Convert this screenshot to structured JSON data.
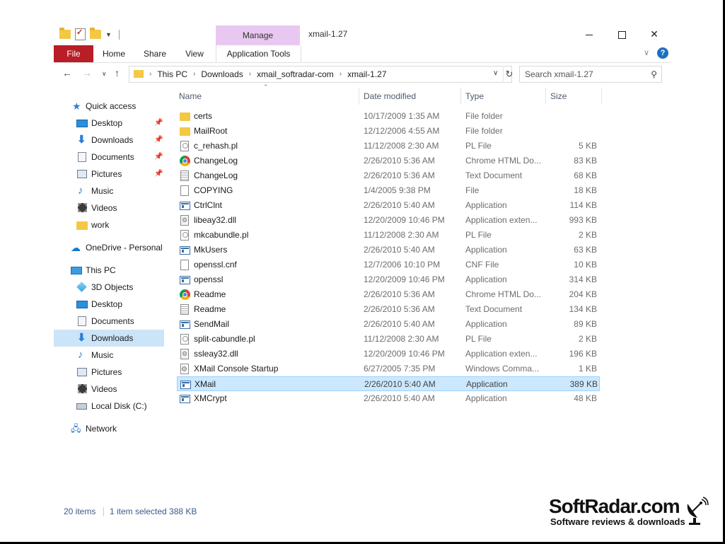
{
  "window": {
    "title": "xmail-1.27",
    "manage_label": "Manage"
  },
  "ribbon": {
    "tabs": [
      "File",
      "Home",
      "Share",
      "View",
      "Application Tools"
    ],
    "help_label": "?"
  },
  "address": {
    "crumbs": [
      "This PC",
      "Downloads",
      "xmail_softradar-com",
      "xmail-1.27"
    ]
  },
  "search": {
    "placeholder": "Search xmail-1.27"
  },
  "sidebar": {
    "items": [
      {
        "label": "Quick access",
        "icon": "star-icon"
      },
      {
        "label": "Desktop",
        "icon": "desktop-icon"
      },
      {
        "label": "Downloads",
        "icon": "download-arrow-icon"
      },
      {
        "label": "Documents",
        "icon": "document-icon"
      },
      {
        "label": "Pictures",
        "icon": "pictures-icon"
      },
      {
        "label": "Music",
        "icon": "music-note-icon"
      },
      {
        "label": "Videos",
        "icon": "video-icon"
      },
      {
        "label": "work",
        "icon": "folder-icon"
      },
      {
        "label": "OneDrive - Personal",
        "icon": "cloud-icon"
      },
      {
        "label": "This PC",
        "icon": "computer-icon"
      },
      {
        "label": "3D Objects",
        "icon": "cube-icon"
      },
      {
        "label": "Desktop",
        "icon": "desktop-icon"
      },
      {
        "label": "Documents",
        "icon": "document-icon"
      },
      {
        "label": "Downloads",
        "icon": "download-arrow-icon"
      },
      {
        "label": "Music",
        "icon": "music-note-icon"
      },
      {
        "label": "Pictures",
        "icon": "pictures-icon"
      },
      {
        "label": "Videos",
        "icon": "video-icon"
      },
      {
        "label": "Local Disk (C:)",
        "icon": "disk-icon"
      },
      {
        "label": "Network",
        "icon": "network-icon"
      }
    ]
  },
  "columns": {
    "name": "Name",
    "date": "Date modified",
    "type": "Type",
    "size": "Size"
  },
  "files": [
    {
      "name": "certs",
      "date": "10/17/2009 1:35 AM",
      "type": "File folder",
      "size": "",
      "icon": "folder"
    },
    {
      "name": "MailRoot",
      "date": "12/12/2006 4:55 AM",
      "type": "File folder",
      "size": "",
      "icon": "folder"
    },
    {
      "name": "c_rehash.pl",
      "date": "11/12/2008 2:30 AM",
      "type": "PL File",
      "size": "5 KB",
      "icon": "pl"
    },
    {
      "name": "ChangeLog",
      "date": "2/26/2010 5:36 AM",
      "type": "Chrome HTML Do...",
      "size": "83 KB",
      "icon": "chrome"
    },
    {
      "name": "ChangeLog",
      "date": "2/26/2010 5:36 AM",
      "type": "Text Document",
      "size": "68 KB",
      "icon": "text"
    },
    {
      "name": "COPYING",
      "date": "1/4/2005 9:38 PM",
      "type": "File",
      "size": "18 KB",
      "icon": "file"
    },
    {
      "name": "CtrlClnt",
      "date": "2/26/2010 5:40 AM",
      "type": "Application",
      "size": "114 KB",
      "icon": "app"
    },
    {
      "name": "libeay32.dll",
      "date": "12/20/2009 10:46 PM",
      "type": "Application exten...",
      "size": "993 KB",
      "icon": "dll"
    },
    {
      "name": "mkcabundle.pl",
      "date": "11/12/2008 2:30 AM",
      "type": "PL File",
      "size": "2 KB",
      "icon": "pl"
    },
    {
      "name": "MkUsers",
      "date": "2/26/2010 5:40 AM",
      "type": "Application",
      "size": "63 KB",
      "icon": "app"
    },
    {
      "name": "openssl.cnf",
      "date": "12/7/2006 10:10 PM",
      "type": "CNF File",
      "size": "10 KB",
      "icon": "file"
    },
    {
      "name": "openssl",
      "date": "12/20/2009 10:46 PM",
      "type": "Application",
      "size": "314 KB",
      "icon": "app"
    },
    {
      "name": "Readme",
      "date": "2/26/2010 5:36 AM",
      "type": "Chrome HTML Do...",
      "size": "204 KB",
      "icon": "chrome"
    },
    {
      "name": "Readme",
      "date": "2/26/2010 5:36 AM",
      "type": "Text Document",
      "size": "134 KB",
      "icon": "text"
    },
    {
      "name": "SendMail",
      "date": "2/26/2010 5:40 AM",
      "type": "Application",
      "size": "89 KB",
      "icon": "app"
    },
    {
      "name": "split-cabundle.pl",
      "date": "11/12/2008 2:30 AM",
      "type": "PL File",
      "size": "2 KB",
      "icon": "pl"
    },
    {
      "name": "ssleay32.dll",
      "date": "12/20/2009 10:46 PM",
      "type": "Application exten...",
      "size": "196 KB",
      "icon": "dll"
    },
    {
      "name": "XMail Console Startup",
      "date": "6/27/2005 7:35 PM",
      "type": "Windows Comma...",
      "size": "1 KB",
      "icon": "cmd"
    },
    {
      "name": "XMail",
      "date": "2/26/2010 5:40 AM",
      "type": "Application",
      "size": "389 KB",
      "icon": "app",
      "selected": true
    },
    {
      "name": "XMCrypt",
      "date": "2/26/2010 5:40 AM",
      "type": "Application",
      "size": "48 KB",
      "icon": "app"
    }
  ],
  "status": {
    "count": "20 items",
    "selected": "1 item selected  388 KB"
  },
  "watermark": {
    "title": "SoftRadar.com",
    "subtitle": "Software reviews & downloads"
  }
}
